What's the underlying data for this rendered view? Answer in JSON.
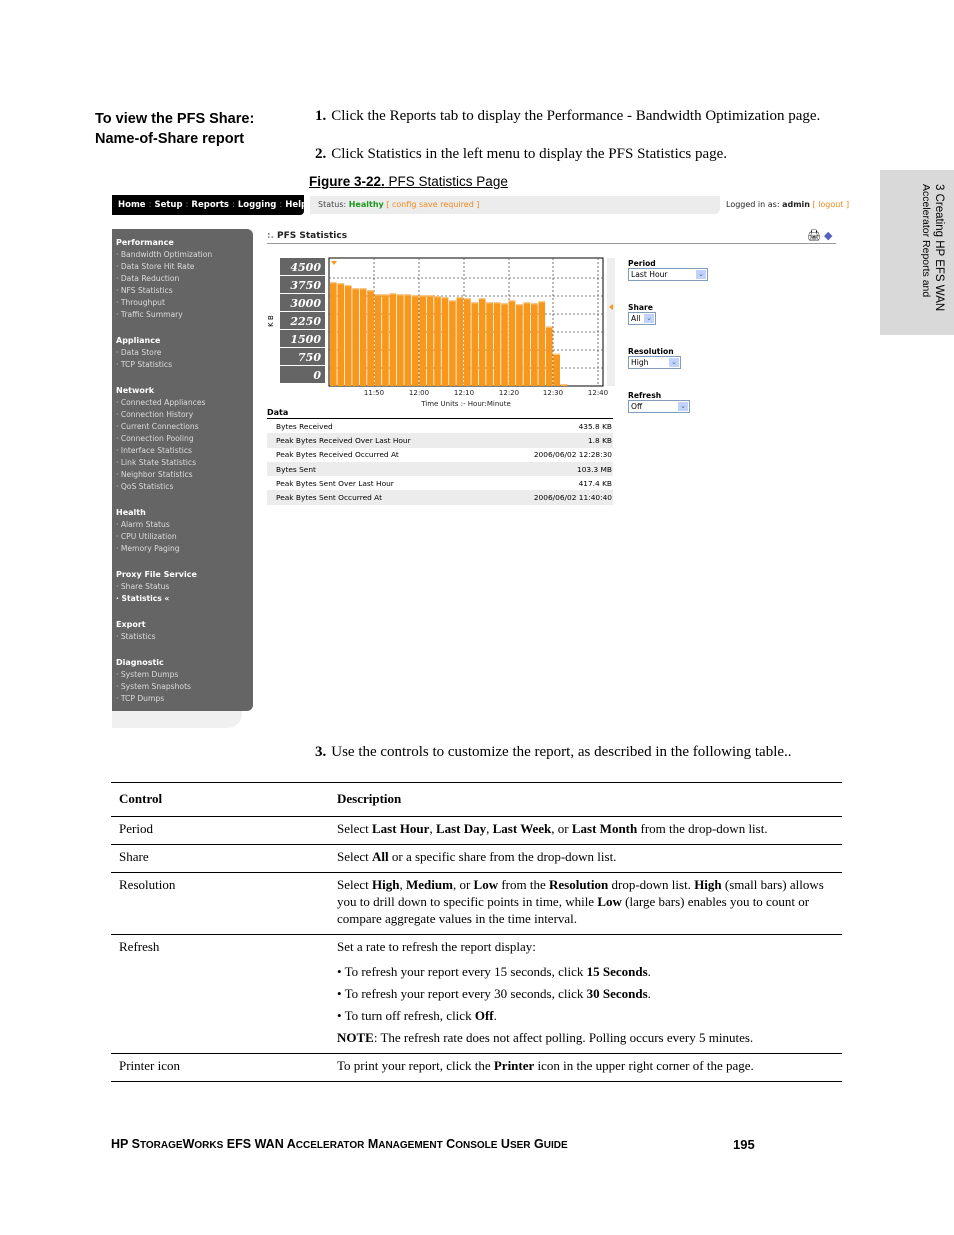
{
  "doc": {
    "side_heading_line1": "To view the PFS Share:",
    "side_heading_line2": "Name-of-Share report",
    "steps": [
      {
        "num": "1.",
        "text": "Click the Reports tab to display the Performance - Bandwidth Optimization page."
      },
      {
        "num": "2.",
        "text": "Click Statistics in the left menu to display the PFS Statistics page."
      },
      {
        "num": "3.",
        "text": "Use the controls to customize the report, as described in the following table.."
      }
    ],
    "figure_label": "Figure 3-22.",
    "figure_title": " PFS Statistics Page",
    "chapter_tab_line1": "3 Creating HP EFS WAN",
    "chapter_tab_line2": "Accelerator Reports and",
    "footer_title": "HP StorageWorks EFS WAN Accelerator Management Console User Guide",
    "page_number": "195"
  },
  "app": {
    "nav": [
      "Home",
      "Setup",
      "Reports",
      "Logging",
      "Help"
    ],
    "status_label": "Status:",
    "status_value": "Healthy",
    "status_note": "config save required",
    "logged_in_label": "Logged in as:",
    "user": "admin",
    "logout": "logout",
    "page_title": "PFS Statistics",
    "icons": [
      "printer-icon",
      "help-book-icon"
    ],
    "menu": [
      {
        "group": "Performance",
        "items": [
          "Bandwidth Optimization",
          "Data Store Hit Rate",
          "Data Reduction",
          "NFS Statistics",
          "Throughput",
          "Traffic Summary"
        ]
      },
      {
        "group": "Appliance",
        "items": [
          "Data Store",
          "TCP Statistics"
        ]
      },
      {
        "group": "Network",
        "items": [
          "Connected Appliances",
          "Connection History",
          "Current Connections",
          "Connection Pooling",
          "Interface Statistics",
          "Link State Statistics",
          "Neighbor Statistics",
          "QoS Statistics"
        ]
      },
      {
        "group": "Health",
        "items": [
          "Alarm Status",
          "CPU Utilization",
          "Memory Paging"
        ]
      },
      {
        "group": "Proxy File Service",
        "items": [
          "Share Status",
          "Statistics «"
        ],
        "active_index": 1
      },
      {
        "group": "Export",
        "items": [
          "Statistics"
        ]
      },
      {
        "group": "Diagnostic",
        "items": [
          "System Dumps",
          "System Snapshots",
          "TCP Dumps"
        ]
      }
    ],
    "data_heading": "Data",
    "data_rows": [
      {
        "label": "Bytes Received",
        "value": "435.8 KB"
      },
      {
        "label": "Peak Bytes Received Over Last Hour",
        "value": "1.8 KB"
      },
      {
        "label": "Peak Bytes Received Occurred At",
        "value": "2006/06/02 12:28:30"
      },
      {
        "label": "Bytes Sent",
        "value": "103.3 MB"
      },
      {
        "label": "Peak Bytes Sent Over Last Hour",
        "value": "417.4 KB"
      },
      {
        "label": "Peak Bytes Sent Occurred At",
        "value": "2006/06/02 11:40:40"
      }
    ],
    "controls": [
      {
        "label": "Period",
        "value": "Last Hour"
      },
      {
        "label": "Share",
        "value": "All"
      },
      {
        "label": "Resolution",
        "value": "High"
      },
      {
        "label": "Refresh",
        "value": "Off"
      }
    ]
  },
  "chart_data": {
    "type": "bar",
    "title": "PFS Statistics",
    "xlabel": "Time Units :- Hour:Minute",
    "ylabel": "K B",
    "ylim": [
      0,
      4500
    ],
    "yticks": [
      "4500",
      "3750",
      "3000",
      "2250",
      "1500",
      "750",
      "0"
    ],
    "xticks": [
      "11:50",
      "12:00",
      "12:10",
      "12:20",
      "12:30",
      "12:40"
    ],
    "grid": true,
    "color": "#f7981d",
    "values": [
      4290,
      4250,
      4170,
      4040,
      4040,
      3960,
      3790,
      3790,
      3830,
      3790,
      3790,
      3750,
      3750,
      3750,
      3710,
      3670,
      3540,
      3670,
      3630,
      3460,
      3630,
      3460,
      3460,
      3420,
      3540,
      3380,
      3460,
      3420,
      3500,
      2460,
      1330,
      80
    ]
  },
  "table": {
    "headers": [
      "Control",
      "Description"
    ],
    "rows": [
      {
        "control": "Period",
        "html": "Select <b>Last Hour</b>, <b>Last Day</b>, <b>Last Week</b>, or <b>Last Month</b> from the drop-down list."
      },
      {
        "control": "Share",
        "html": "Select <b>All</b> or a specific share from the drop-down list."
      },
      {
        "control": "Resolution",
        "html": "Select <b>High</b>, <b>Medium</b>, or <b>Low</b> from the <b>Resolution</b> drop-down list. <b>High</b> (small bars) allows you to drill down to specific points in time, while <b>Low</b> (large bars) enables you to count or compare aggregate values in the time interval."
      },
      {
        "control": "Refresh",
        "html": "Set a rate to refresh the report display:<div class=\"bul\"><div>• To refresh your report every 15 seconds, click <b>15 Seconds</b>.</div><div>• To refresh your report every 30 seconds, click <b>30 Seconds</b>.</div><div>• To turn off refresh, click <b>Off</b>.</div><div><b>NOTE</b>: The refresh rate does not affect polling. Polling occurs every 5 minutes.</div></div>"
      },
      {
        "control": "Printer icon",
        "html": "To print your report, click the <b>Printer</b> icon in the upper right corner of the page."
      }
    ]
  }
}
